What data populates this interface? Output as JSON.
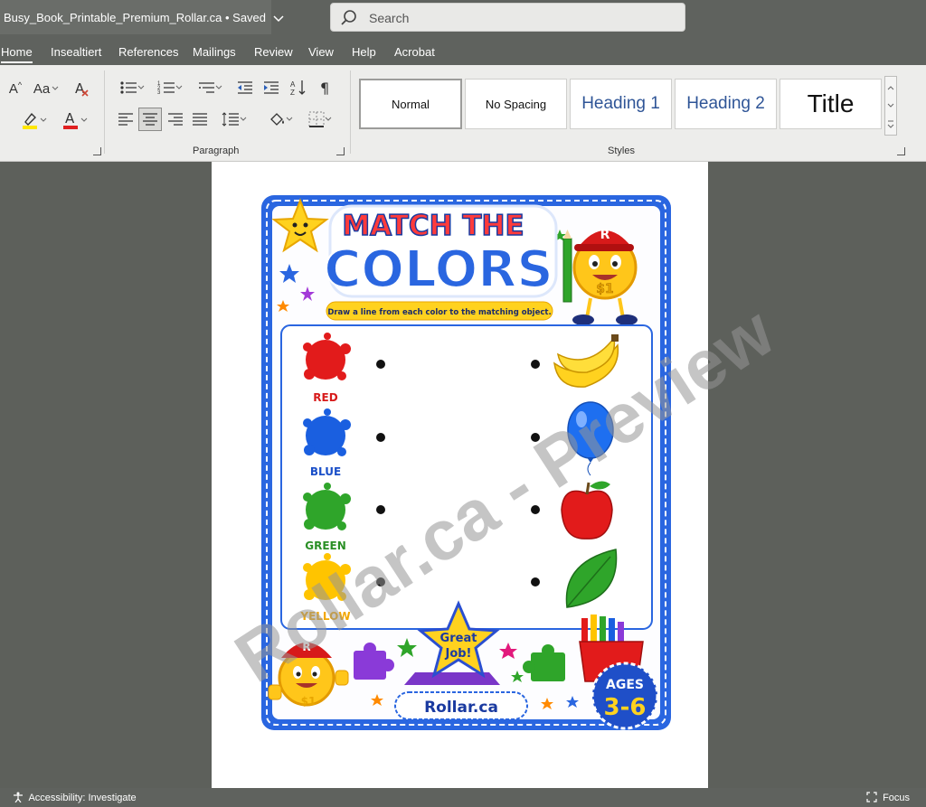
{
  "titlebar": {
    "filename": "Busy_Book_Printable_Premium_Rollar.ca",
    "status": "Saved",
    "search_placeholder": "Search"
  },
  "tabs": [
    {
      "label": "Home",
      "active": true
    },
    {
      "label": "Insealtiert"
    },
    {
      "label": "References"
    },
    {
      "label": "Mailings"
    },
    {
      "label": "Review"
    },
    {
      "label": "View"
    },
    {
      "label": "Help"
    },
    {
      "label": "Acrobat"
    }
  ],
  "ribbon": {
    "groups": {
      "paragraph": "Paragraph",
      "styles": "Styles"
    },
    "styles": [
      "Normal",
      "No Spacing",
      "Heading 1",
      "Heading 2",
      "Title"
    ],
    "font_buttons": {
      "grow": "A",
      "case": "Aa",
      "highlight": "A",
      "font_color": "A"
    },
    "colors": {
      "highlight": "#ffe600",
      "font_color": "#e02020",
      "heading": "#2f5597"
    }
  },
  "worksheet": {
    "title_line1": "MATCH THE",
    "title_line2": "COLORS",
    "instruction": "Draw a line from each color to the matching object.",
    "colors": [
      {
        "label": "RED",
        "hex": "#e21b1b",
        "text_color": "#d71a1a"
      },
      {
        "label": "BLUE",
        "hex": "#1a5fe0",
        "text_color": "#1a4fc8"
      },
      {
        "label": "GREEN",
        "hex": "#2fa52a",
        "text_color": "#2a8f25"
      },
      {
        "label": "YELLOW",
        "hex": "#ffc400",
        "text_color": "#f2a700"
      }
    ],
    "objects": [
      "banana-icon",
      "balloon-icon",
      "apple-icon",
      "leaf-icon"
    ],
    "badge": "Great Job!",
    "badge_line1": "Great",
    "badge_line2": "Job!",
    "site": "Rollar.ca",
    "ages_label": "AGES",
    "ages_range": "3-6",
    "mascot_letter": "R",
    "mascot_coin": "$1"
  },
  "watermark": "Rollar.ca - Preview",
  "statusbar": {
    "accessibility": "Accessibility: Investigate",
    "focus": "Focus"
  }
}
